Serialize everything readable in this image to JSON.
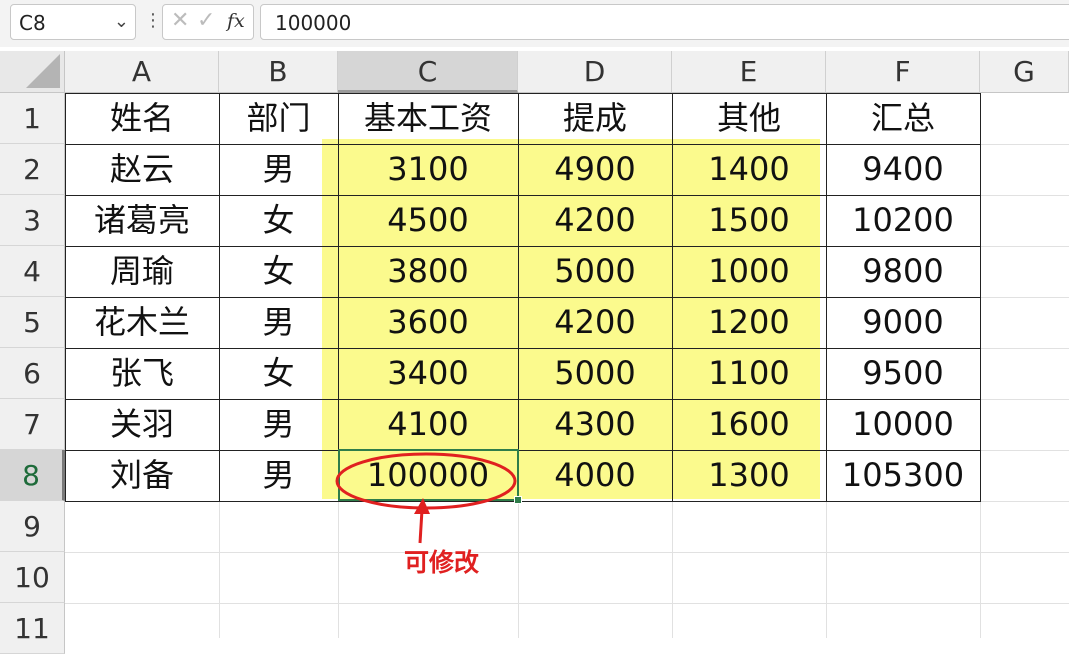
{
  "formula_bar": {
    "name_box": "C8",
    "name_box_arrow": "⌄",
    "separator": "⋮",
    "cancel_icon": "✕",
    "enter_icon": "✓",
    "fx_label": "fx",
    "value": "100000"
  },
  "column_headers": [
    "A",
    "B",
    "C",
    "D",
    "E",
    "F",
    "G"
  ],
  "row_headers": [
    "1",
    "2",
    "3",
    "4",
    "5",
    "6",
    "7",
    "8",
    "9",
    "10",
    "11"
  ],
  "table": {
    "headers": [
      "姓名",
      "部门",
      "基本工资",
      "提成",
      "其他",
      "汇总"
    ],
    "rows": [
      [
        "赵云",
        "男",
        "3100",
        "4900",
        "1400",
        "9400"
      ],
      [
        "诸葛亮",
        "女",
        "4500",
        "4200",
        "1500",
        "10200"
      ],
      [
        "周瑜",
        "女",
        "3800",
        "5000",
        "1000",
        "9800"
      ],
      [
        "花木兰",
        "男",
        "3600",
        "4200",
        "1200",
        "9000"
      ],
      [
        "张飞",
        "女",
        "3400",
        "5000",
        "1100",
        "9500"
      ],
      [
        "关羽",
        "男",
        "4100",
        "4300",
        "1600",
        "10000"
      ],
      [
        "刘备",
        "男",
        "100000",
        "4000",
        "1300",
        "105300"
      ]
    ]
  },
  "annotation": {
    "text": "可修改",
    "color": "#e02020"
  },
  "colors": {
    "highlight": "#fbfa83",
    "selection": "#2f7d4a"
  }
}
